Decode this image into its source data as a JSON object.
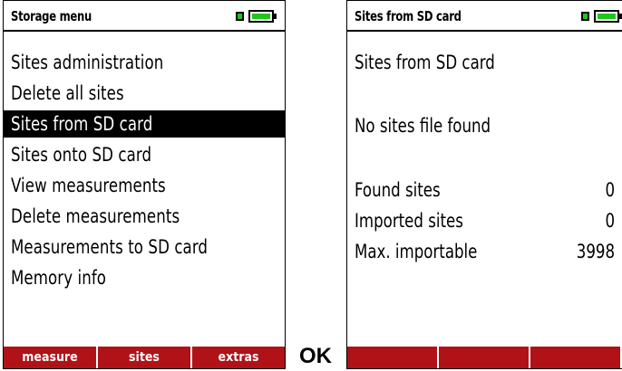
{
  "left_screen": {
    "title": "Storage menu",
    "menu_items": [
      "Sites administration",
      "Delete all sites",
      "Sites from SD card",
      "Sites onto SD card",
      "View measurements",
      "Delete measurements",
      "Measurements to SD card",
      "Memory info"
    ],
    "selected_index": 2,
    "softkeys": [
      "measure",
      "sites",
      "extras"
    ]
  },
  "ok_label": "OK",
  "right_screen": {
    "title": "Sites from SD card",
    "heading": "Sites from SD card",
    "message": "No sites file found",
    "rows": [
      {
        "label": "Found sites",
        "value": "0"
      },
      {
        "label": "Imported sites",
        "value": "0"
      },
      {
        "label": "Max. importable",
        "value": "3998"
      }
    ],
    "softkeys": [
      "",
      "",
      ""
    ]
  },
  "colors": {
    "softkey_bar": "#b01218",
    "battery_green": "#1fc41f",
    "selection": "#000000"
  },
  "icons": [
    "battery-icon"
  ]
}
